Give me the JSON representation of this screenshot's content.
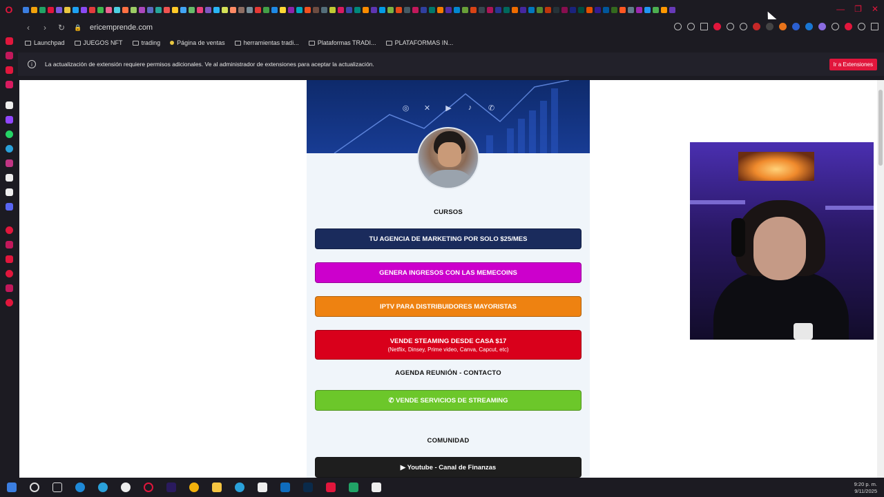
{
  "browser": {
    "url": "ericemprende.com",
    "bookmarks": [
      "Launchpad",
      "JUEGOS NFT",
      "trading",
      "Página de ventas",
      "herramientas tradi...",
      "Plataformas TRADI...",
      "PLATAFORMAS IN..."
    ],
    "infobar_text": "La actualización de extensión requiere permisos adicionales. Ve al administrador de extensiones para aceptar la actualización.",
    "infobar_button": "Ir a Extensiones",
    "tab_icon_colors": [
      "#3b7ee0",
      "#f2a20c",
      "#21a366",
      "#e1163c",
      "#7b5be0",
      "#e8c640",
      "#1da1f2",
      "#8a4af3",
      "#e33c3c",
      "#3fb950",
      "#f06292",
      "#4dd0e1",
      "#ff7043",
      "#9ccc65",
      "#ab47bc",
      "#5c6bc0",
      "#26a69a",
      "#ef5350",
      "#ffca28",
      "#42a5f5",
      "#66bb6a",
      "#ec407a",
      "#7e57c2",
      "#29b6f6",
      "#d4e157",
      "#ff8a65",
      "#8d6e63",
      "#78909c",
      "#e53935",
      "#43a047",
      "#1e88e5",
      "#fdd835",
      "#8e24aa",
      "#00acc1",
      "#f4511e",
      "#6d4c41",
      "#546e7a",
      "#c0ca33",
      "#d81b60",
      "#3949ab",
      "#00897b",
      "#fb8c00",
      "#5e35b1",
      "#039be5",
      "#7cb342",
      "#e64a19",
      "#455a64",
      "#c2185b",
      "#303f9f",
      "#00796b",
      "#f57c00",
      "#512da8",
      "#0288d1",
      "#689f38",
      "#d84315",
      "#37474f",
      "#ad1457",
      "#283593",
      "#00695c",
      "#ef6c00",
      "#4527a0",
      "#0277bd",
      "#558b2f",
      "#bf360c",
      "#263238",
      "#880e4f",
      "#1a237e",
      "#004d40",
      "#e65100",
      "#311b92",
      "#01579b",
      "#33691e",
      "#ff5722",
      "#607d8b",
      "#9c27b0",
      "#2196f3",
      "#4caf50",
      "#ff9800",
      "#673ab7"
    ]
  },
  "page": {
    "hero_socials": [
      "instagram-icon",
      "x-icon",
      "youtube-icon",
      "tiktok-icon",
      "whatsapp-icon"
    ],
    "section_courses": "CURSOS",
    "buttons": [
      {
        "label": "TU AGENCIA DE MARKETING POR SOLO $25/MES",
        "color": "#1a2b5c"
      },
      {
        "label": "GENERA INGRESOS CON LAS MEMECOINS",
        "color": "#cc00cc"
      },
      {
        "label": "IPTV PARA DISTRIBUIDORES MAYORISTAS",
        "color": "#ee8211"
      },
      {
        "label": "VENDE STEAMING DESDE CASA $17",
        "sub": "(Netflix, Dinsey, Prime video, Canva, Capcut, etc)",
        "color": "#d9001b"
      }
    ],
    "section_contact": "AGENDA REUNIÓN - CONTACTO",
    "contact_button": {
      "label": "VENDE SERVICIOS DE STREAMING",
      "color": "#6cc72a"
    },
    "section_community": "COMUNIDAD",
    "community_button": {
      "label": "Youtube - Canal de Finanzas",
      "color": "#1e1e1e"
    }
  },
  "taskbar": {
    "time": "9:20 p. m.",
    "date": "9/11/2025",
    "icons": [
      "windows-icon",
      "search-icon",
      "task-view-icon",
      "chatgpt-icon",
      "edge-icon",
      "github-icon",
      "opera-icon",
      "premiere-icon",
      "chrome-icon",
      "files-icon",
      "telegram-icon",
      "capcut-icon",
      "outlook-icon",
      "photoshop-icon",
      "tiktok-icon",
      "excel-icon",
      "capcut-alt-icon"
    ]
  }
}
